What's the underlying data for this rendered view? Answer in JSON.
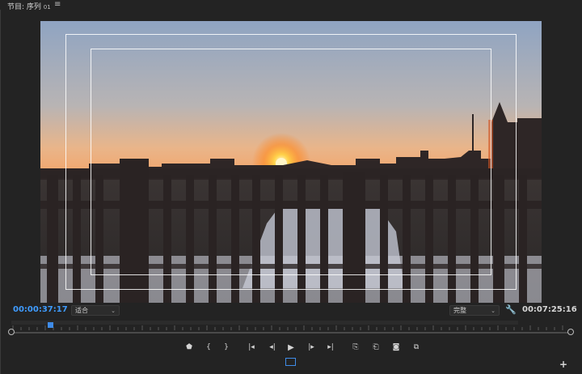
{
  "panel": {
    "title": "节目: 序列",
    "title_suffix": "01",
    "menu_icon": "hamburger-menu-icon"
  },
  "viewer": {
    "content": "sunset-over-railing-video-frame",
    "safe_margins_visible": true
  },
  "timecode": {
    "current": "00:00:37:17",
    "duration": "00:07:25:16",
    "current_color": "#3f9cff"
  },
  "fit_select": {
    "value": "适合"
  },
  "quality_select": {
    "value": "完整"
  },
  "timeline": {
    "playhead_fraction": 0.083
  },
  "controls": [
    {
      "name": "add-marker-button",
      "icon": "marker-icon",
      "glyph": "⬟"
    },
    {
      "name": "mark-in-button",
      "icon": "mark-in-icon",
      "glyph": "{"
    },
    {
      "name": "mark-out-button",
      "icon": "mark-out-icon",
      "glyph": "}"
    },
    {
      "name": "go-to-in-button",
      "icon": "go-to-in-icon",
      "glyph": "|◂"
    },
    {
      "name": "step-back-button",
      "icon": "step-back-icon",
      "glyph": "◂|"
    },
    {
      "name": "play-button",
      "icon": "play-icon",
      "glyph": "▶"
    },
    {
      "name": "step-forward-button",
      "icon": "step-forward-icon",
      "glyph": "|▸"
    },
    {
      "name": "go-to-out-button",
      "icon": "go-to-out-icon",
      "glyph": "▸|"
    },
    {
      "name": "lift-button",
      "icon": "lift-icon",
      "glyph": "⎘"
    },
    {
      "name": "extract-button",
      "icon": "extract-icon",
      "glyph": "⎗"
    },
    {
      "name": "export-frame-button",
      "icon": "camera-icon",
      "glyph": "◙"
    },
    {
      "name": "compare-view-button",
      "icon": "compare-icon",
      "glyph": "⧉"
    }
  ],
  "colors": {
    "accent": "#3f8ce8",
    "panel_bg": "#232323"
  }
}
